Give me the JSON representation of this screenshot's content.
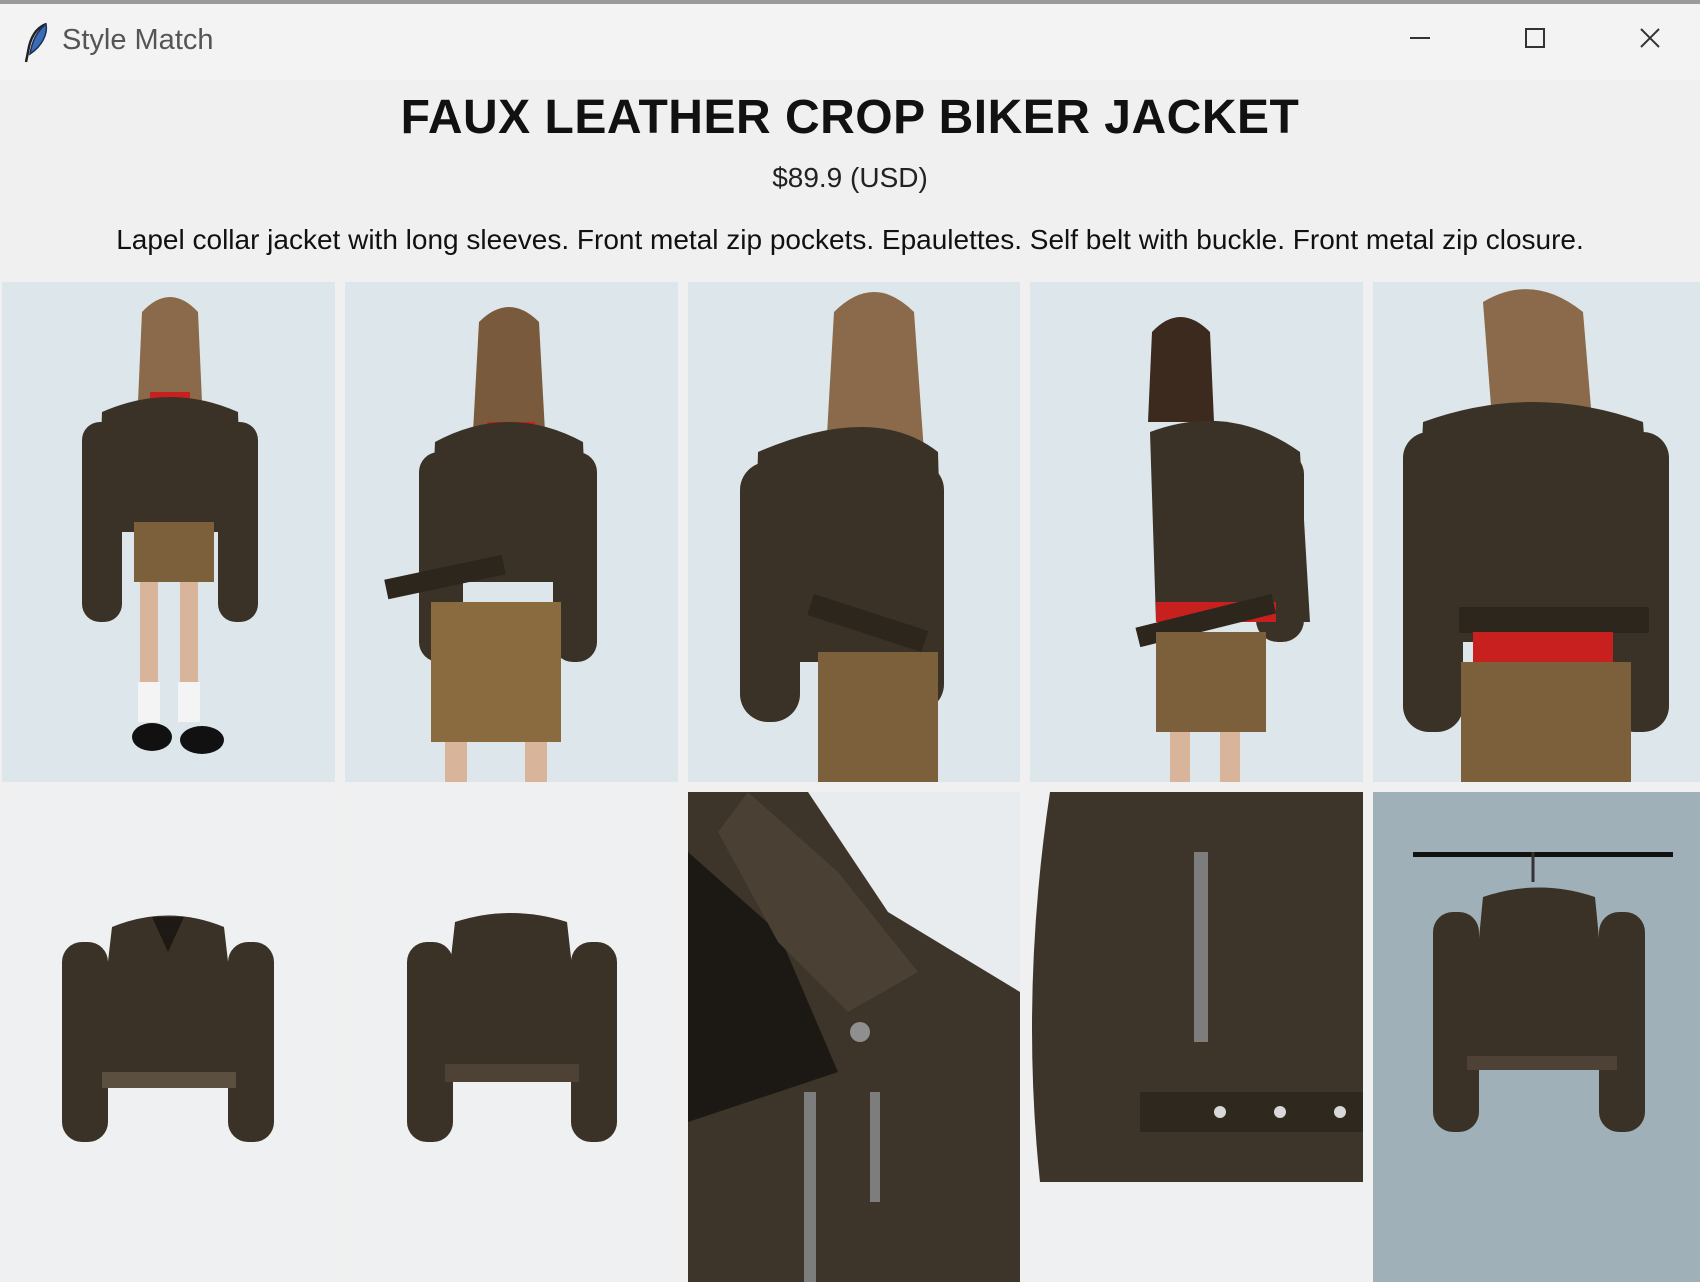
{
  "window": {
    "title": "Style Match",
    "icon": "feather-icon",
    "controls": [
      "minimize-icon",
      "maximize-icon",
      "close-icon"
    ]
  },
  "product": {
    "name": "FAUX LEATHER CROP BIKER JACKET",
    "price": "$89.9 (USD)",
    "description": "Lapel collar jacket with long sleeves. Front metal zip pockets. Epaulettes. Self belt with buckle. Front metal zip closure."
  },
  "gallery": {
    "rows": 2,
    "columns": 5,
    "images": [
      {
        "name": "model-front-full-image"
      },
      {
        "name": "model-front-belt-image"
      },
      {
        "name": "model-three-quarter-image"
      },
      {
        "name": "model-side-image"
      },
      {
        "name": "model-back-image"
      },
      {
        "name": "jacket-flat-front-image"
      },
      {
        "name": "jacket-flat-back-image"
      },
      {
        "name": "jacket-collar-detail-image"
      },
      {
        "name": "jacket-pocket-detail-image"
      },
      {
        "name": "jacket-hanger-image"
      }
    ]
  },
  "colors": {
    "background": "#f0f0f0",
    "leather": "#3a3226",
    "studio_backdrop": "#dfe7ea"
  }
}
